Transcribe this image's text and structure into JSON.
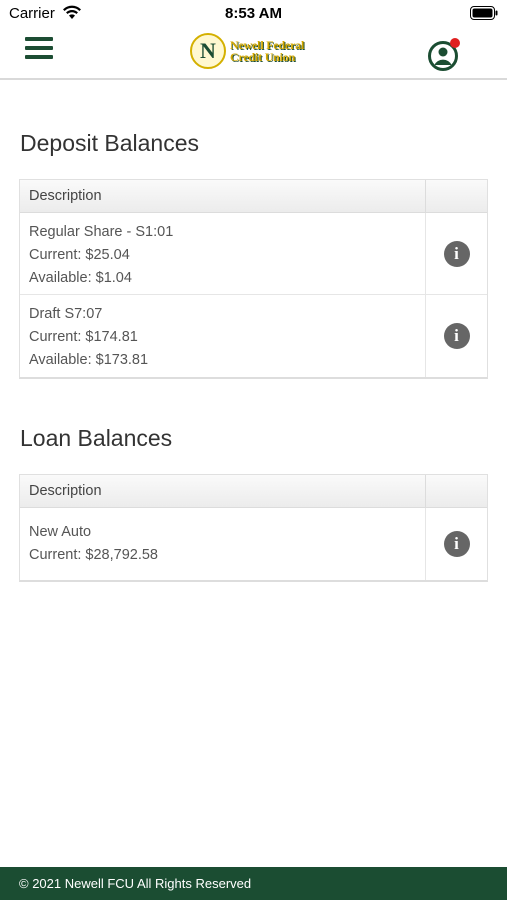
{
  "status_bar": {
    "carrier": "Carrier",
    "time": "8:53 AM"
  },
  "header": {
    "logo_mark": "N",
    "logo_line1": "Newell Federal",
    "logo_line2": "Credit Union",
    "notification_color": "#e02020"
  },
  "deposit": {
    "title": "Deposit Balances",
    "column_header": "Description",
    "rows": [
      {
        "name": "Regular Share - S1:01",
        "current": "Current: $25.04",
        "available": "Available: $1.04"
      },
      {
        "name": "Draft S7:07",
        "current": "Current: $174.81",
        "available": "Available: $173.81"
      }
    ]
  },
  "loan": {
    "title": "Loan Balances",
    "column_header": "Description",
    "rows": [
      {
        "name": "New Auto",
        "current": "Current: $28,792.58"
      }
    ]
  },
  "icons": {
    "info": "i"
  },
  "footer": {
    "text": "© 2021 Newell FCU All Rights Reserved"
  },
  "colors": {
    "brand_green": "#1b4d32",
    "logo_gold": "#d4a800",
    "info_gray": "#666666"
  }
}
